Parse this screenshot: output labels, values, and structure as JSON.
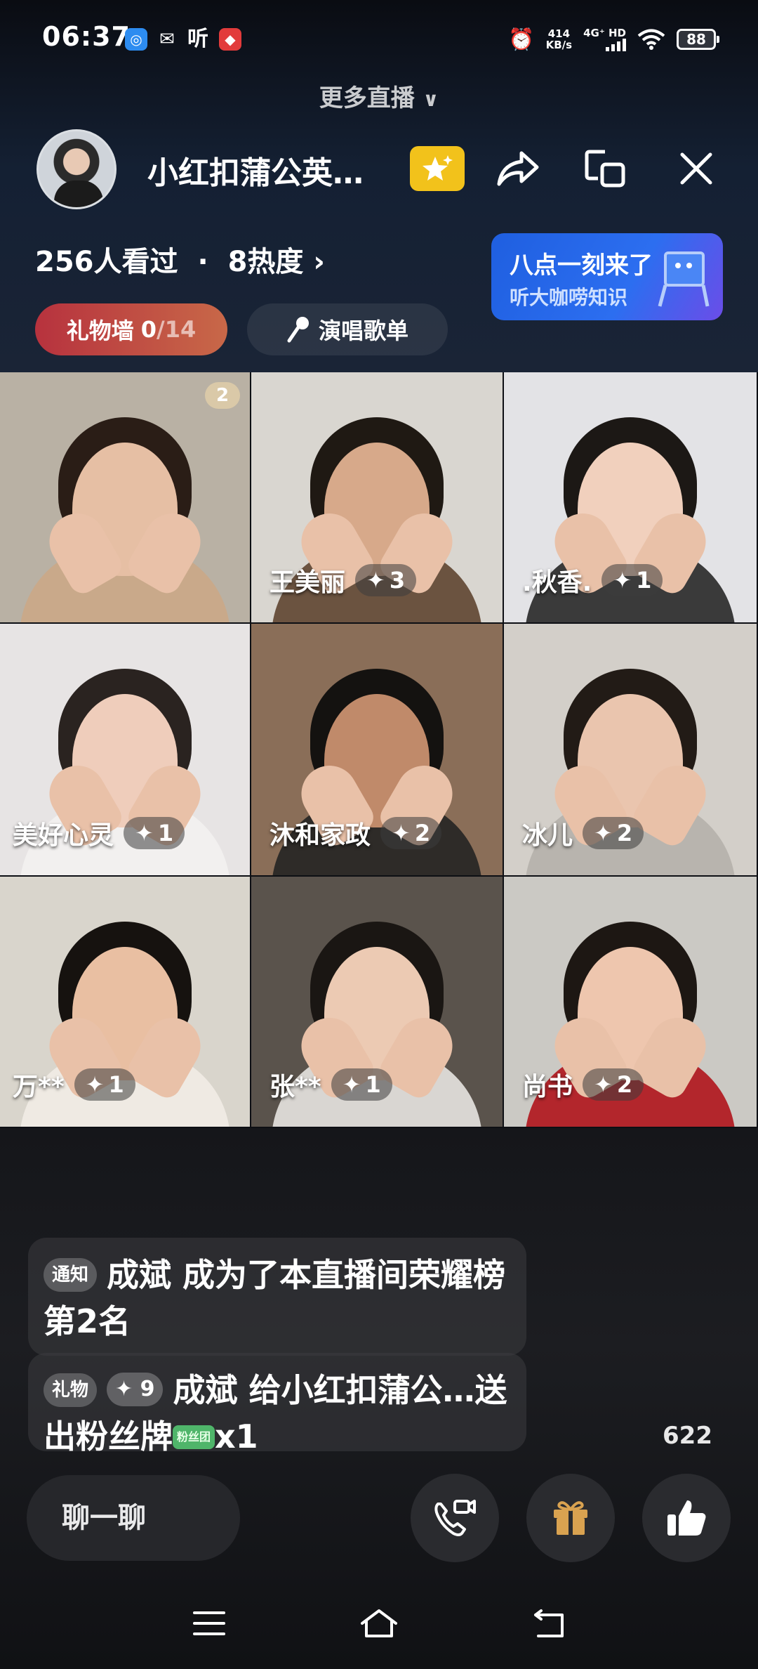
{
  "status_bar": {
    "time": "06:37",
    "apps": [
      "听"
    ],
    "net_speed_value": "414",
    "net_speed_unit": "KB/s",
    "network": "4G⁺ HD",
    "battery": "88"
  },
  "more_live": "更多直播",
  "header": {
    "title": "小红扣蒲公英…",
    "viewers": "256人看过",
    "separator": "·",
    "heat": "8热度",
    "chevron": "›"
  },
  "ad": {
    "title": "八点一刻来了",
    "subtitle": "听大咖唠知识"
  },
  "gift_wall": {
    "label": "礼物墙",
    "current": "0",
    "total": "/14"
  },
  "song_list": {
    "label": "演唱歌单"
  },
  "tiles": [
    {
      "name": "",
      "score": "",
      "badge": "2",
      "colors": {
        "bg": "#b9b1a4",
        "body": "#c9a98a",
        "hair": "#2a1d16",
        "face": "#e6bfa4"
      }
    },
    {
      "name": "王美丽",
      "score": "3",
      "colors": {
        "bg": "#d9d6d0",
        "body": "#6b5340",
        "hair": "#1f1913",
        "face": "#d7a98a"
      }
    },
    {
      "name": ".秋香.",
      "score": "1",
      "colors": {
        "bg": "#e3e3e6",
        "body": "#3a3a3a",
        "hair": "#1c1815",
        "face": "#f1d0bd"
      }
    },
    {
      "name": "美好心灵",
      "score": "1",
      "colors": {
        "bg": "#e7e4e4",
        "body": "#f2f0ef",
        "hair": "#2a2320",
        "face": "#efcdbb"
      }
    },
    {
      "name": "沐和家政",
      "score": "2",
      "colors": {
        "bg": "#8a6e58",
        "body": "#2e2b28",
        "hair": "#141210",
        "face": "#c08a6a"
      }
    },
    {
      "name": "冰儿",
      "score": "2",
      "colors": {
        "bg": "#d3cfc9",
        "body": "#b8b4ae",
        "hair": "#221b16",
        "face": "#eac5ae"
      }
    },
    {
      "name": "万**",
      "score": "1",
      "colors": {
        "bg": "#d9d5cc",
        "body": "#efeae3",
        "hair": "#16120f",
        "face": "#e9bfa2"
      }
    },
    {
      "name": "张**",
      "score": "1",
      "colors": {
        "bg": "#5a534c",
        "body": "#d9d6d2",
        "hair": "#1a1613",
        "face": "#eccab3"
      }
    },
    {
      "name": "尚书",
      "score": "2",
      "colors": {
        "bg": "#cbc9c4",
        "body": "#b3262c",
        "hair": "#1d1713",
        "face": "#eec6ae"
      }
    }
  ],
  "chat": [
    {
      "tag": "通知",
      "text": "成斌 成为了本直播间荣耀榜第2名"
    },
    {
      "tag": "礼物",
      "plus": "9",
      "text": "成斌 给小红扣蒲公…送出粉丝牌",
      "badge": "粉丝团",
      "count": "x1"
    }
  ],
  "like_count": "622",
  "bottom_bar": {
    "chat_label": "聊一聊"
  },
  "colors": {
    "accent_gold": "#f2c21b",
    "gift_wall": "#b7323e",
    "ad_blue": "#1f5fe0",
    "gift_icon": "#d9a250"
  },
  "icons": [
    "share-icon",
    "picture-in-picture-icon",
    "close-icon",
    "mic-icon",
    "video-call-icon",
    "gift-icon",
    "thumbs-up-icon",
    "menu-icon",
    "home-icon",
    "back-icon"
  ]
}
